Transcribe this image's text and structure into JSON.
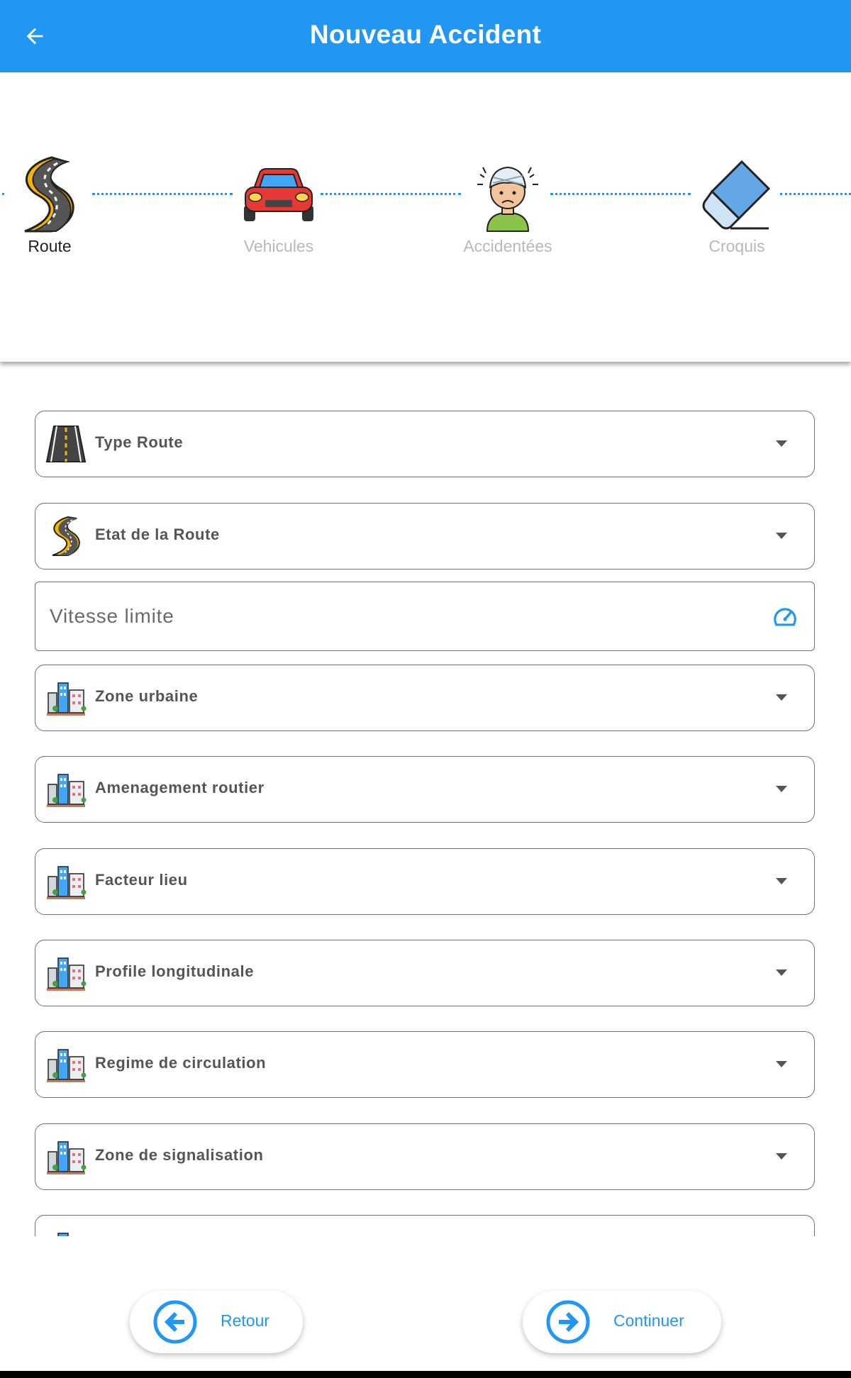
{
  "appbar": {
    "title": "Nouveau Accident",
    "back_icon": "arrow-back-icon",
    "background": "#2196f3"
  },
  "stepper": {
    "steps": [
      {
        "label": "Route",
        "icon": "road-icon",
        "active": true
      },
      {
        "label": "Vehicules",
        "icon": "car-icon",
        "active": false
      },
      {
        "label": "Accidentées",
        "icon": "injured-person-icon",
        "active": false
      },
      {
        "label": "Croquis",
        "icon": "eraser-icon",
        "active": false
      }
    ]
  },
  "form": {
    "fields": [
      {
        "label": "Type Route",
        "icon": "straight-road-icon"
      },
      {
        "label": "Etat de la Route",
        "icon": "curved-road-icon"
      },
      {
        "label": "Zone urbaine",
        "icon": "city-buildings-icon"
      },
      {
        "label": "Amenagement routier",
        "icon": "city-buildings-icon"
      },
      {
        "label": "Facteur lieu",
        "icon": "city-buildings-icon"
      },
      {
        "label": "Profile longitudinale",
        "icon": "city-buildings-icon"
      },
      {
        "label": "Regime de circulation",
        "icon": "city-buildings-icon"
      },
      {
        "label": "Zone de signalisation",
        "icon": "city-buildings-icon"
      }
    ],
    "speed_limit": {
      "placeholder": "Vitesse limite",
      "value": "",
      "icon": "speedometer-icon"
    }
  },
  "buttons": {
    "back_label": "Retour",
    "continue_label": "Continuer"
  },
  "colors": {
    "accent": "#2196f3",
    "inactive_step": "#b8b8b8"
  }
}
